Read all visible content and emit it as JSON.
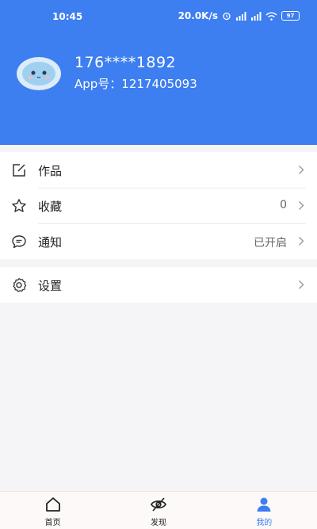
{
  "status_bar": {
    "time": "10:45",
    "speed": "20.0K/s",
    "battery": "97"
  },
  "profile": {
    "phone": "176****1892",
    "app_id": "App号：1217405093"
  },
  "menu": {
    "works": {
      "label": "作品",
      "icon": "edit-icon"
    },
    "favorites": {
      "label": "收藏",
      "value": "0",
      "icon": "star-icon"
    },
    "notifications": {
      "label": "通知",
      "value": "已开启",
      "icon": "chat-icon"
    },
    "settings": {
      "label": "设置",
      "icon": "gear-icon"
    }
  },
  "tabs": [
    {
      "label": "首页",
      "icon": "home-icon",
      "active": false
    },
    {
      "label": "发现",
      "icon": "eye-off-icon",
      "active": false
    },
    {
      "label": "我的",
      "icon": "user-icon",
      "active": true
    }
  ],
  "colors": {
    "accent": "#3d7ef0",
    "background": "#f5f5f7"
  }
}
